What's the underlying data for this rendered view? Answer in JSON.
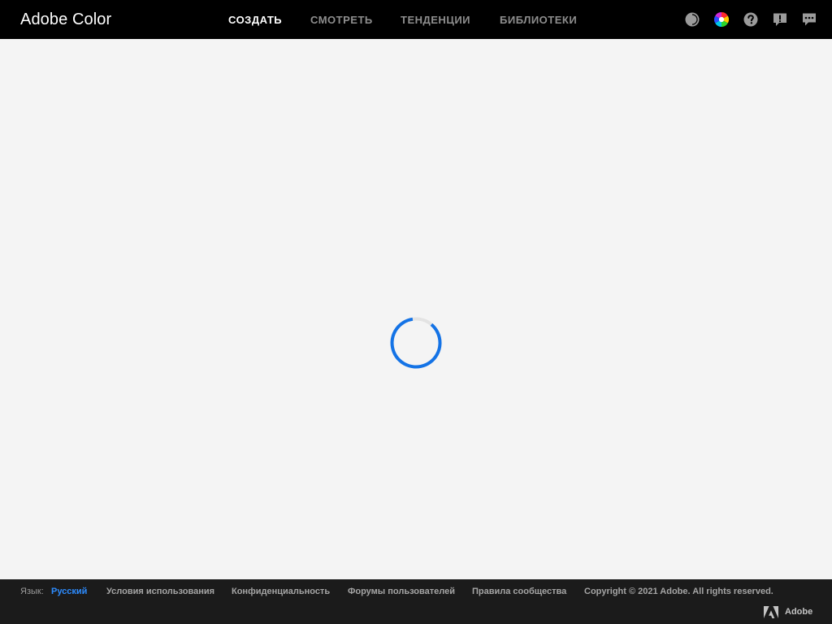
{
  "header": {
    "brand": "Adobe Color",
    "tabs": [
      {
        "label": "СОЗДАТЬ",
        "active": true
      },
      {
        "label": "СМОТРЕТЬ",
        "active": false
      },
      {
        "label": "ТЕНДЕНЦИИ",
        "active": false
      },
      {
        "label": "БИБЛИОТЕКИ",
        "active": false
      }
    ],
    "icons": [
      "accessibility-icon",
      "color-wheel-icon",
      "help-icon",
      "notice-icon",
      "feedback-icon"
    ]
  },
  "main": {
    "loading": true,
    "spinner_color": "#1473e6"
  },
  "footer": {
    "language_label": "Язык:",
    "language_value": "Русский",
    "links": [
      "Условия использования",
      "Конфиденциальность",
      "Форумы пользователей",
      "Правила сообщества"
    ],
    "copyright": "Copyright © 2021 Adobe. All rights reserved.",
    "adobe_wordmark": "Adobe"
  },
  "colors": {
    "topbar_bg": "#000000",
    "page_bg": "#f4f4f4",
    "footer_bg": "#1b1b1b",
    "accent_link": "#2d8cff",
    "tab_inactive": "#8e8e8e",
    "tab_active": "#ffffff"
  }
}
